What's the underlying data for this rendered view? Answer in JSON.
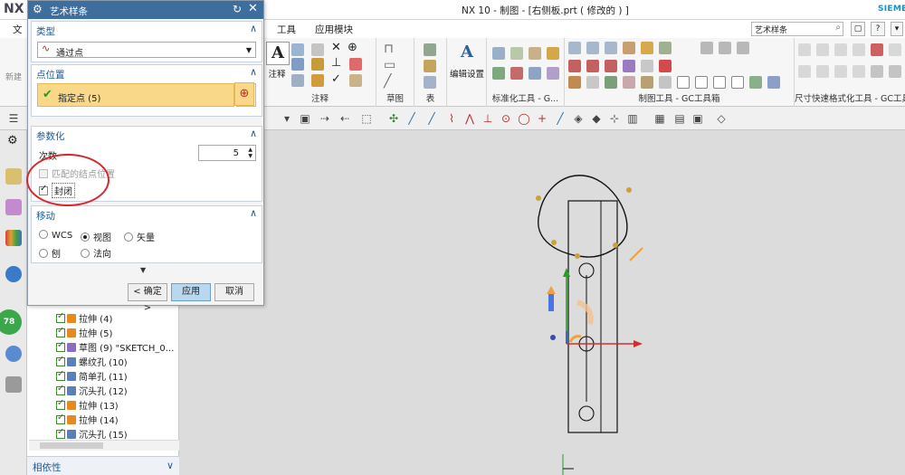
{
  "app": {
    "logo": "NX",
    "window_title": "NX 10 - 制图 - [右侧板.prt  ( 修改的 ) ]",
    "brand": "SIEME"
  },
  "ribbon_tabs": {
    "file_partial": "文",
    "tools": "工具",
    "app_module": "应用模块"
  },
  "search": {
    "value": "艺术样条"
  },
  "ribbon": {
    "new_partial": "新建",
    "annotation_button": "注释",
    "annotation_group": "注释",
    "sketch_group": "草图",
    "table_group": "表",
    "edit_settings": "编辑设置",
    "std_tools_group": "标准化工具 - G...",
    "drafting_tools_group": "制图工具 - GC工具箱",
    "dim_format_group": "尺寸快速格式化工具 - GC工具..."
  },
  "dialog": {
    "title": "艺术样条",
    "type": {
      "section": "类型",
      "selected": "通过点"
    },
    "point_location": {
      "section": "点位置",
      "specify_point": "指定点 (5)"
    },
    "parameterization": {
      "section": "参数化",
      "degree_label": "次数",
      "degree_value": "5",
      "match_knots": "匹配的结点位置",
      "closed": "封闭"
    },
    "movement": {
      "section": "移动",
      "wcs": "WCS",
      "view": "视图",
      "vector": "矢量",
      "plane": "刨",
      "normal": "法向"
    },
    "buttons": {
      "ok": "< 确定 >",
      "apply": "应用",
      "cancel": "取消"
    }
  },
  "navigator": {
    "rows": [
      {
        "label": "拉伸 (4)",
        "icon": "extrude-icon",
        "color": "#e58a1f"
      },
      {
        "label": "拉伸 (5)",
        "icon": "extrude-icon",
        "color": "#e58a1f"
      },
      {
        "label": "草图 (9) \"SKETCH_0...",
        "icon": "sketch-icon",
        "color": "#8a6fc0"
      },
      {
        "label": "螺纹孔 (10)",
        "icon": "thread-hole-icon",
        "color": "#5b7fb8"
      },
      {
        "label": "简单孔 (11)",
        "icon": "simple-hole-icon",
        "color": "#5b7fb8"
      },
      {
        "label": "沉头孔 (12)",
        "icon": "counterbore-icon",
        "color": "#5b7fb8"
      },
      {
        "label": "拉伸 (13)",
        "icon": "extrude-icon",
        "color": "#e58a1f"
      },
      {
        "label": "拉伸 (14)",
        "icon": "extrude-icon",
        "color": "#e58a1f"
      },
      {
        "label": "沉头孔 (15)",
        "icon": "counterbore-icon",
        "color": "#5b7fb8"
      }
    ],
    "dependencies": "相依性"
  },
  "resource_bar": {
    "badge": "78"
  },
  "colors": {
    "accent": "#3e6e9e",
    "selection": "#f9d88a",
    "annotation": "#d9262b",
    "spline_points": "#c9a23a"
  }
}
